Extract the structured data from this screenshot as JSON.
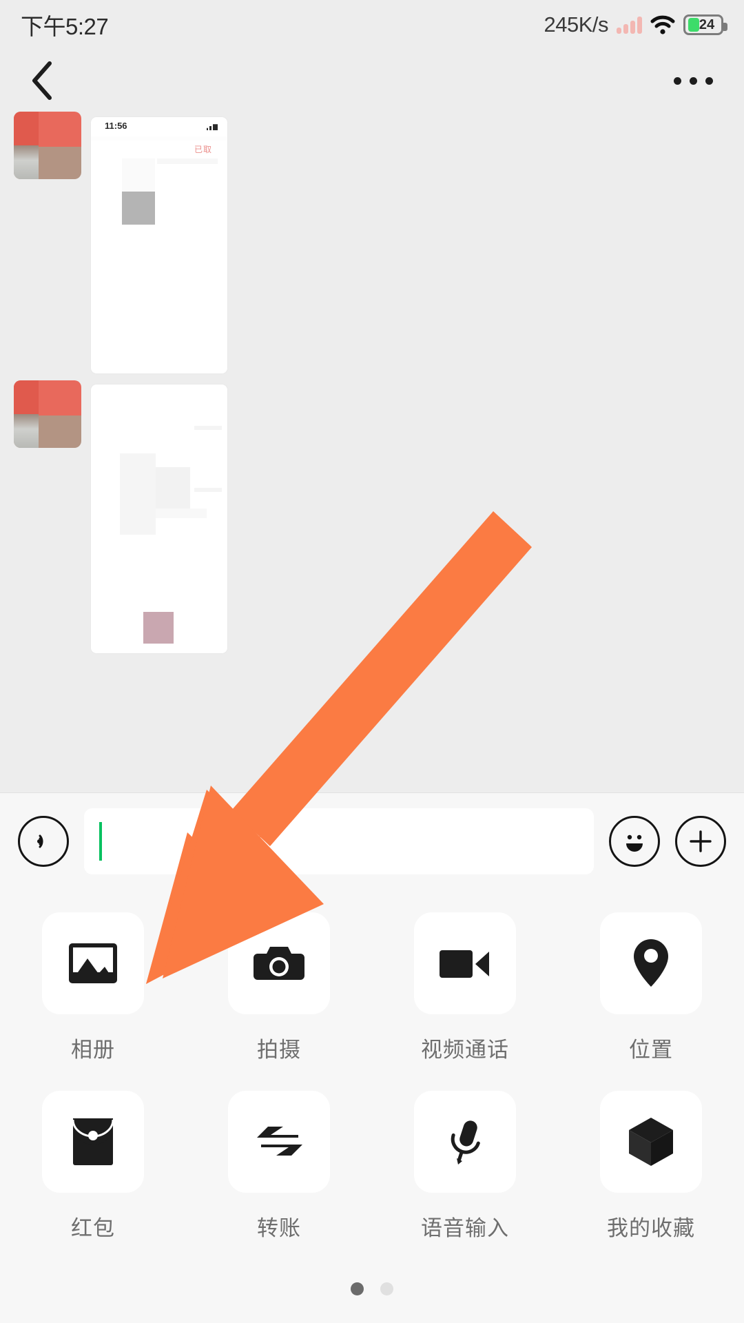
{
  "status_bar": {
    "time": "下午5:27",
    "network_speed": "245K/s",
    "battery_level": "24",
    "icons": {
      "signal": "signal-bars-icon",
      "wifi": "wifi-icon",
      "battery": "battery-icon"
    },
    "colors": {
      "signal_bars": "#f3b7b2",
      "battery_fill": "#3ddc6a",
      "battery_outline": "#7c7c7c"
    }
  },
  "nav_bar": {
    "back_icon": "chevron-left-icon",
    "more_icon": "more-horizontal-icon",
    "title": ""
  },
  "chat": {
    "messages": [
      {
        "sender": "other",
        "type": "image",
        "screenshot_time": "11:56",
        "screenshot_note": "已取"
      },
      {
        "sender": "other",
        "type": "image"
      }
    ]
  },
  "input_bar": {
    "voice_icon": "voice-wave-icon",
    "text_value": "",
    "placeholder": "",
    "emoji_icon": "smiley-face-icon",
    "plus_icon": "plus-circle-icon",
    "caret_color": "#07c160"
  },
  "attach_panel": {
    "items": [
      {
        "label": "相册",
        "icon": "photo-album-icon"
      },
      {
        "label": "拍摄",
        "icon": "camera-icon"
      },
      {
        "label": "视频通话",
        "icon": "video-call-icon"
      },
      {
        "label": "位置",
        "icon": "location-pin-icon"
      },
      {
        "label": "红包",
        "icon": "red-packet-icon"
      },
      {
        "label": "转账",
        "icon": "transfer-arrows-icon"
      },
      {
        "label": "语音输入",
        "icon": "microphone-icon"
      },
      {
        "label": "我的收藏",
        "icon": "cube-favorites-icon"
      }
    ],
    "page_indicator": {
      "total": 2,
      "active": 1
    }
  },
  "annotation": {
    "arrow_color": "#fb7b43",
    "target_label": "相册",
    "icon": "pointer-arrow-icon"
  }
}
